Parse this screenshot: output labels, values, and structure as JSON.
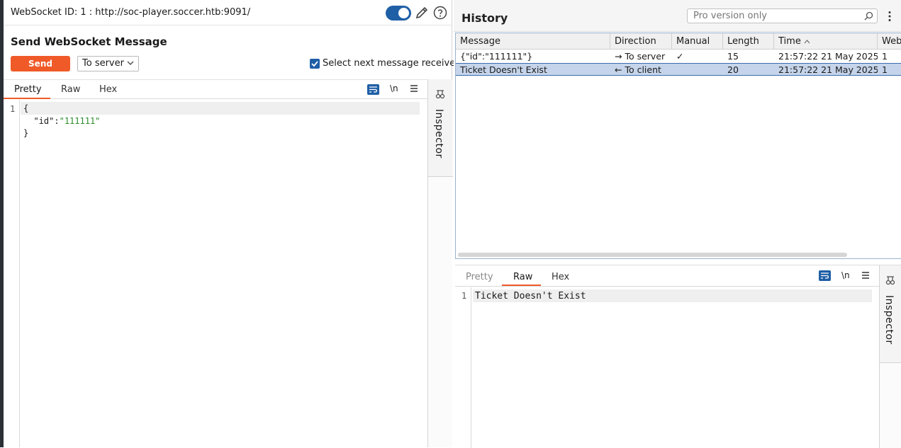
{
  "header": {
    "ws_id": "WebSocket ID: 1 : http://soc-player.soccer.htb:9091/"
  },
  "send": {
    "title": "Send WebSocket Message",
    "send_label": "Send",
    "direction": "To server",
    "select_next_label": "Select next message received"
  },
  "editor_tabs": {
    "pretty": "Pretty",
    "raw": "Raw",
    "hex": "Hex",
    "newline": "\\n"
  },
  "editor": {
    "line_number": "1",
    "line1": "{",
    "key": "\"id\"",
    "colon": ":",
    "value": "\"111111\"",
    "line3": "}"
  },
  "inspector": {
    "label": "Inspector"
  },
  "history": {
    "title": "History",
    "search_placeholder": "Pro version only",
    "columns": [
      "Message",
      "Direction",
      "Manual",
      "Length",
      "Time",
      "Web"
    ],
    "rows": [
      {
        "message": "{\"id\":\"111111\"}",
        "direction": "→ To server",
        "manual": "✓",
        "length": "15",
        "time": "21:57:22 21 May 2025",
        "web": "1"
      },
      {
        "message": "Ticket Doesn't Exist",
        "direction": "← To client",
        "manual": "",
        "length": "20",
        "time": "21:57:22 21 May 2025",
        "web": "1"
      }
    ]
  },
  "viewer": {
    "line_number": "1",
    "content": "Ticket Doesn't Exist"
  },
  "colors": {
    "accent": "#f05a28",
    "toggle": "#1f5fa6",
    "selected_row": "#c5d4ea"
  }
}
